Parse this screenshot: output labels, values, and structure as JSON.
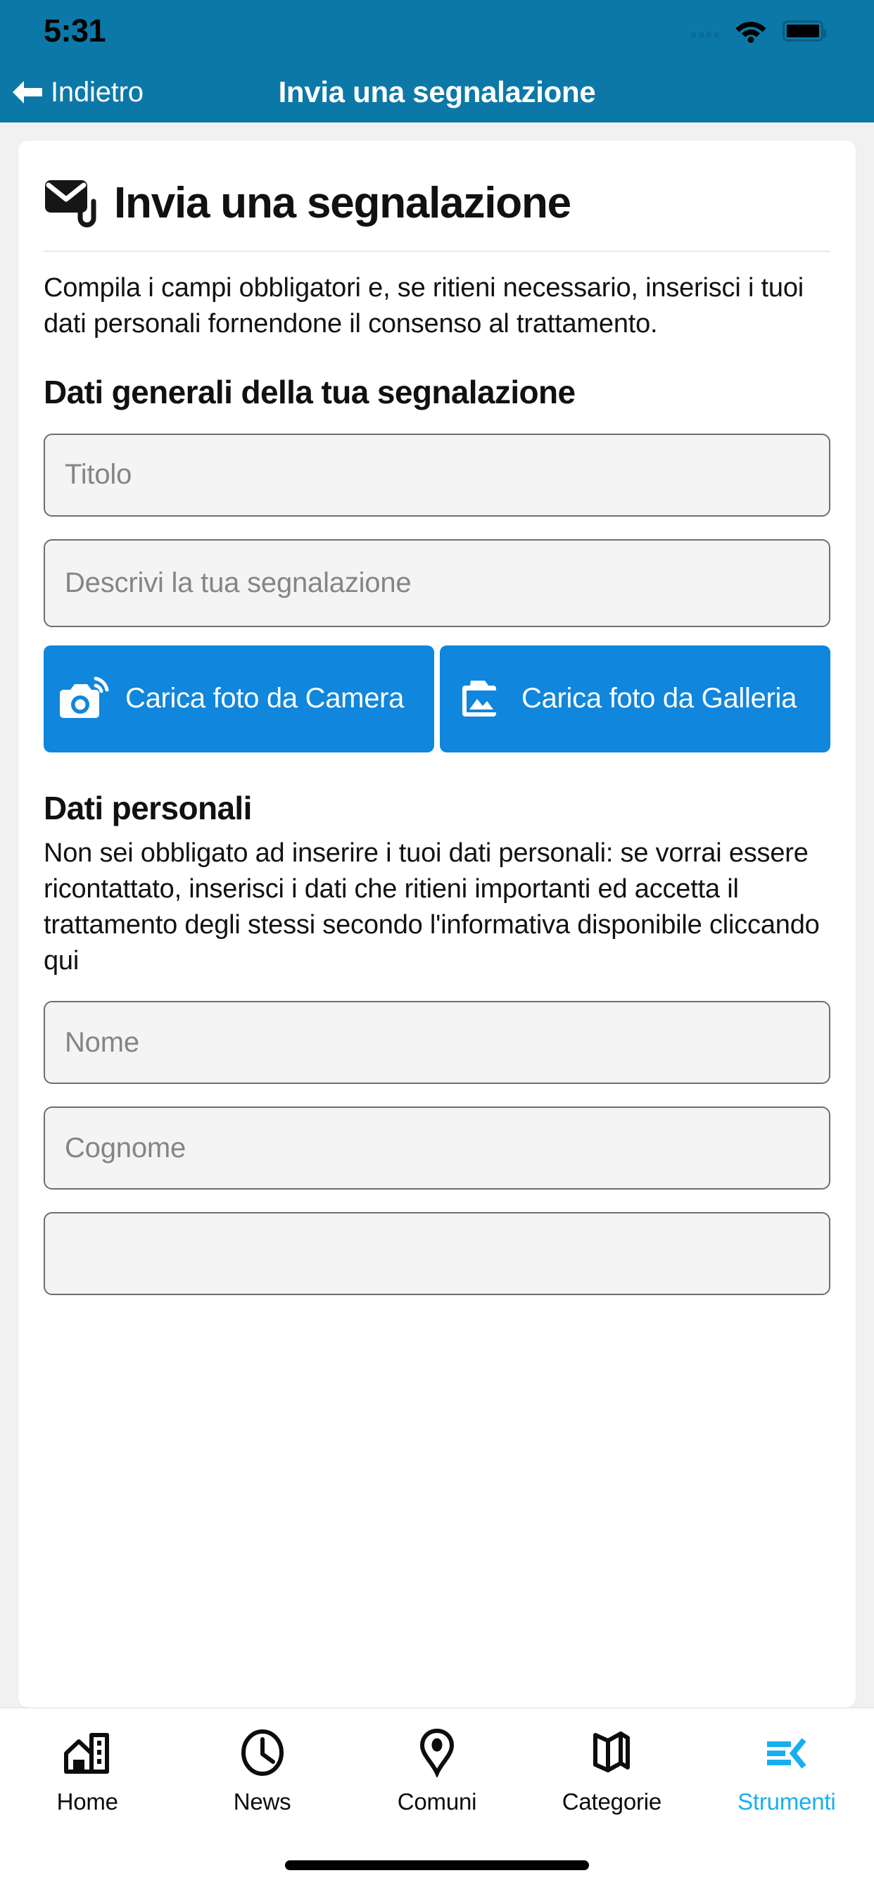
{
  "statusbar": {
    "time": "5:31",
    "wifi_icon": "wifi-icon",
    "battery_icon": "battery-icon",
    "signal_icon": "signal-dots-icon"
  },
  "navbar": {
    "back_label": "Indietro",
    "back_icon": "arrow-left-icon",
    "title": "Invia una segnalazione"
  },
  "card": {
    "icon": "mail-attachment-icon",
    "title": "Invia una segnalazione",
    "intro": "Compila i campi obbligatori e, se ritieni necessario, inserisci i tuoi dati personali fornendone il consenso al trattamento.",
    "general_section": {
      "heading": "Dati generali della tua segnalazione",
      "fields": [
        {
          "name": "titolo",
          "placeholder": "Titolo",
          "value": ""
        },
        {
          "name": "descrizione",
          "placeholder": "Descrivi la tua segnalazione",
          "value": ""
        }
      ],
      "buttons": [
        {
          "name": "carica-foto-camera",
          "label": "Carica foto da Camera",
          "icon": "camera-icon"
        },
        {
          "name": "carica-foto-galleria",
          "label": "Carica foto da Galleria",
          "icon": "image-gallery-icon"
        }
      ]
    },
    "personal_section": {
      "heading": "Dati personali",
      "intro": "Non sei obbligato ad inserire i tuoi dati personali: se vorrai essere ricontattato, inserisci i dati che ritieni importanti ed accetta il trattamento degli stessi secondo l'informativa disponibile cliccando qui",
      "fields": [
        {
          "name": "nome",
          "placeholder": "Nome",
          "value": ""
        },
        {
          "name": "cognome",
          "placeholder": "Cognome",
          "value": ""
        },
        {
          "name": "terzo-campo",
          "placeholder": "",
          "value": ""
        }
      ]
    }
  },
  "tabbar": {
    "items": [
      {
        "name": "home",
        "label": "Home",
        "icon": "buildings-icon",
        "active": false
      },
      {
        "name": "news",
        "label": "News",
        "icon": "clock-icon",
        "active": false
      },
      {
        "name": "comuni",
        "label": "Comuni",
        "icon": "map-pin-icon",
        "active": false
      },
      {
        "name": "categorie",
        "label": "Categorie",
        "icon": "map-icon",
        "active": false
      },
      {
        "name": "strumenti",
        "label": "Strumenti",
        "icon": "tools-list-icon",
        "active": true
      }
    ]
  },
  "colors": {
    "header_blue": "#0c78a8",
    "button_blue": "#1086dd",
    "active_tab": "#17aff0",
    "page_bg": "#f1f1f1",
    "card_bg": "#ffffff",
    "field_bg": "#f4f4f4",
    "field_border": "#6e6e6e",
    "placeholder": "#858585"
  }
}
